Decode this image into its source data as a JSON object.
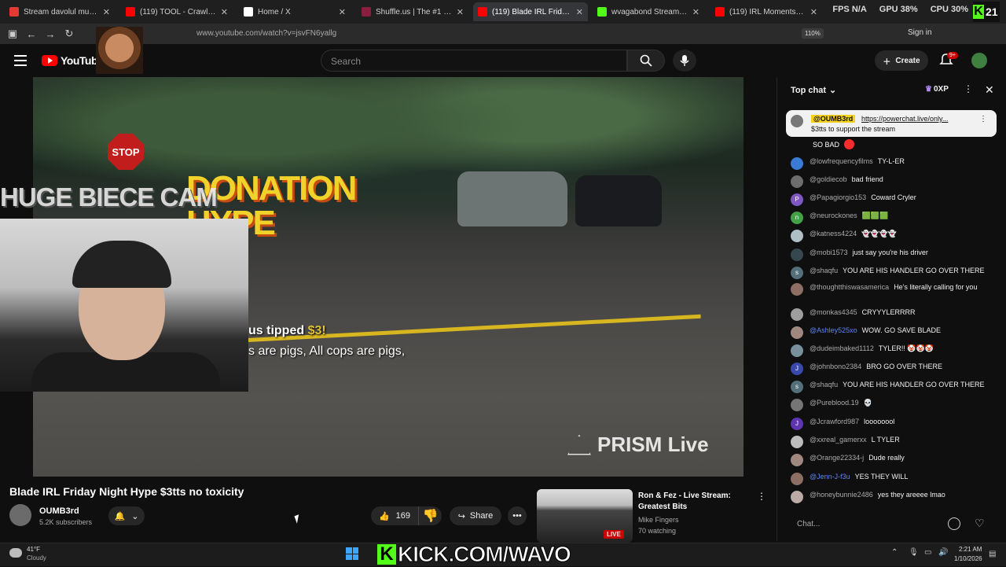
{
  "browser": {
    "tabs": [
      {
        "label": "Stream davolul music | Listen to",
        "active": false,
        "favicon_color": "#e53935"
      },
      {
        "label": "(119) TOOL - Crawl Away (Audio",
        "active": false,
        "favicon_color": "#ff0000"
      },
      {
        "label": "Home / X",
        "active": false,
        "favicon_color": "#ffffff"
      },
      {
        "label": "Shuffle.us | The #1 Free to Play",
        "active": false,
        "favicon_color": "#8b1e3f"
      },
      {
        "label": "(119) Blade IRL Friday Night",
        "active": true,
        "favicon_color": "#ff0000"
      },
      {
        "label": "wvagabond Stream - Watch Live",
        "active": false,
        "favicon_color": "#53fc18"
      },
      {
        "label": "(119) IRL Moments - YouTube",
        "active": false,
        "favicon_color": "#ff0000"
      }
    ],
    "url": "www.youtube.com/watch?v=jsvFN6yallg",
    "zoom": "110%",
    "sign_in": "Sign in",
    "stats": {
      "fps": "FPS N/A",
      "gpu": "GPU 38%",
      "cpu": "CPU 30%"
    },
    "kick_count": "21"
  },
  "youtube": {
    "logo_text": "YouTube",
    "search_placeholder": "Search",
    "create_label": "Create",
    "notif_badge": "9+"
  },
  "video": {
    "overlay_huge": "HUGE BIECE CAM",
    "overlay_donation": "DONATION HYPE",
    "stop_sign": "STOP",
    "tip_prefix": "us tipped",
    "tip_amount": "$3!",
    "caption": "s are pigs, All cops are pigs,",
    "watermark": "PRISM Live",
    "title": "Blade IRL Friday Night Hype $3tts no toxicity",
    "channel": "OUMB3rd",
    "subscribers": "5.2K subscribers",
    "likes": "169",
    "share_label": "Share"
  },
  "recommended": {
    "title": "Ron & Fez - Live Stream: Greatest Bits",
    "channel": "Mike Fingers",
    "watching": "70 watching",
    "live": "LIVE"
  },
  "chat": {
    "header": "Top chat",
    "xp": "0XP",
    "pinned": {
      "user": "@OUMB3rd",
      "link": "https://powerchat.live/only...",
      "text": "$3tts to support the stream"
    },
    "pinned_tail": "SO BAD",
    "messages": [
      {
        "user": "@lowfrequencyfilms",
        "text": "TY-L-ER",
        "av": "#3a7bd5",
        "initial": "",
        "mod": false
      },
      {
        "user": "@goldiecob",
        "text": "bad friend",
        "av": "#6d6d6d",
        "initial": "",
        "mod": false
      },
      {
        "user": "@Papagiorgio153",
        "text": "Coward Cryler",
        "av": "#7e57c2",
        "initial": "P",
        "mod": false
      },
      {
        "user": "@neurockones",
        "text": "🟩🟩🟩",
        "av": "#43a047",
        "initial": "n",
        "mod": false
      },
      {
        "user": "@katness4224",
        "text": "👻👻👻👻",
        "av": "#b0bec5",
        "initial": "",
        "mod": false
      },
      {
        "user": "@mobi1573",
        "text": "just say you're his driver",
        "av": "#37474f",
        "initial": "",
        "mod": false
      },
      {
        "user": "@shaqfu",
        "text": "YOU ARE HIS HANDLER GO OVER THERE",
        "av": "#546e7a",
        "initial": "s",
        "mod": false
      },
      {
        "user": "@thoughtthiswasamerica",
        "text": "He's literally calling for you",
        "av": "#8d6e63",
        "initial": "",
        "mod": false
      },
      {
        "user": "@monkas4345",
        "text": "CRYYYLERRRR",
        "av": "#9e9e9e",
        "initial": "",
        "mod": false
      },
      {
        "user": "@Ashley525xo",
        "text": "WOW. GO SAVE BLADE",
        "av": "#a1887f",
        "initial": "",
        "mod": true
      },
      {
        "user": "@dudeimbaked1112",
        "text": "TYLER!! 🤡🤡🤡",
        "av": "#78909c",
        "initial": "",
        "mod": false
      },
      {
        "user": "@johnbono2384",
        "text": "BRO GO OVER THERE",
        "av": "#3949ab",
        "initial": "J",
        "mod": false
      },
      {
        "user": "@shaqfu",
        "text": "YOU ARE HIS HANDLER GO OVER THERE",
        "av": "#546e7a",
        "initial": "s",
        "mod": false
      },
      {
        "user": "@Pureblood.19",
        "text": "💀",
        "av": "#757575",
        "initial": "",
        "mod": false
      },
      {
        "user": "@Jcrawford987",
        "text": "loooooool",
        "av": "#5e35b1",
        "initial": "J",
        "mod": false
      },
      {
        "user": "@xxreal_gamerxx",
        "text": "L TYLER",
        "av": "#bdbdbd",
        "initial": "",
        "mod": false
      },
      {
        "user": "@Orange22334-j",
        "text": "Dude really",
        "av": "#a1887f",
        "initial": "",
        "mod": false
      },
      {
        "user": "@Jenn-J-f3u",
        "text": "YES THEY WILL",
        "av": "#8d6e63",
        "initial": "",
        "mod": true
      },
      {
        "user": "@honeybunnie2486",
        "text": "yes they areeee lmao",
        "av": "#bcaaa4",
        "initial": "",
        "mod": false
      }
    ],
    "input_placeholder": "Chat..."
  },
  "taskbar": {
    "temp": "41°F",
    "weather": "Cloudy",
    "kick_banner": "KICK.COM/WAVO",
    "time": "2:21 AM",
    "date": "1/10/2026"
  }
}
